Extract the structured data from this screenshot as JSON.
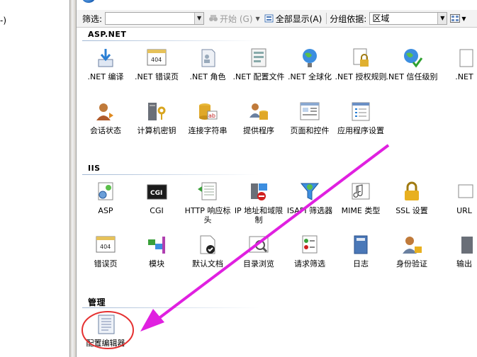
{
  "left_pane": {
    "tree_fragment": "-)"
  },
  "filter_bar": {
    "filter_label": "筛选:",
    "go_label": "开始 (G)",
    "show_all_label": "全部显示(A)",
    "group_by_label": "分组依据:",
    "group_by_value": "区域"
  },
  "sections": {
    "aspnet": {
      "title": "ASP.NET",
      "items": [
        {
          "label": ".NET 编译",
          "icon": "download-arrow-icon"
        },
        {
          "label": ".NET 错误页",
          "icon": "error-404-icon"
        },
        {
          "label": ".NET 角色",
          "icon": "document-users-icon"
        },
        {
          "label": ".NET 配置文件",
          "icon": "profile-doc-icon"
        },
        {
          "label": ".NET 全球化",
          "icon": "globe-icon"
        },
        {
          "label": ".NET 授权规则",
          "icon": "lock-doc-icon"
        },
        {
          "label": ".NET 信任级别",
          "icon": "globe-check-icon"
        },
        {
          "label": ".NET",
          "icon": "doc-icon"
        },
        {
          "label": "会话状态",
          "icon": "user-session-icon"
        },
        {
          "label": "计算机密钥",
          "icon": "server-key-icon"
        },
        {
          "label": "连接字符串",
          "icon": "database-ab-icon"
        },
        {
          "label": "提供程序",
          "icon": "users-db-icon"
        },
        {
          "label": "页面和控件",
          "icon": "page-controls-icon"
        },
        {
          "label": "应用程序设置",
          "icon": "app-settings-icon"
        }
      ]
    },
    "iis": {
      "title": "IIS",
      "items": [
        {
          "label": "ASP",
          "icon": "asp-gear-icon"
        },
        {
          "label": "CGI",
          "icon": "cgi-icon"
        },
        {
          "label": "HTTP 响应标头",
          "icon": "http-headers-icon"
        },
        {
          "label": "IP 地址和域限制",
          "icon": "ip-restrict-icon"
        },
        {
          "label": "ISAPI 筛选器",
          "icon": "isapi-filter-icon"
        },
        {
          "label": "MIME 类型",
          "icon": "mime-icon"
        },
        {
          "label": "SSL 设置",
          "icon": "padlock-icon"
        },
        {
          "label": "URL",
          "icon": "url-icon"
        },
        {
          "label": "错误页",
          "icon": "error-page-icon"
        },
        {
          "label": "模块",
          "icon": "modules-icon"
        },
        {
          "label": "默认文档",
          "icon": "default-doc-icon"
        },
        {
          "label": "目录浏览",
          "icon": "dir-browse-icon"
        },
        {
          "label": "请求筛选",
          "icon": "request-filter-icon"
        },
        {
          "label": "日志",
          "icon": "log-book-icon"
        },
        {
          "label": "身份验证",
          "icon": "auth-user-icon"
        },
        {
          "label": "输出",
          "icon": "output-cache-icon"
        }
      ]
    },
    "management": {
      "title": "管理",
      "items": [
        {
          "label": "配置编辑器",
          "icon": "config-editor-icon"
        }
      ]
    }
  },
  "annotation": {
    "arrow_color": "#e020e0",
    "circle_color": "#e53030"
  },
  "colors": {
    "accent": "#1a5fb4"
  }
}
